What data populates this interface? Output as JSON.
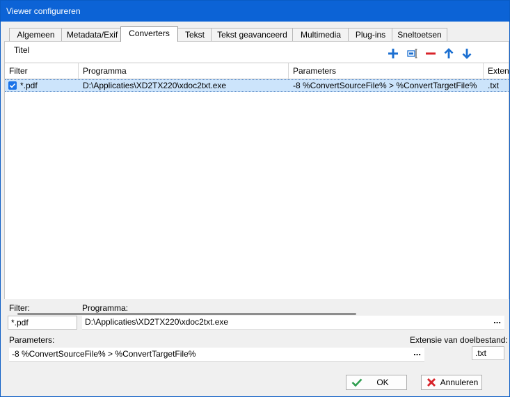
{
  "window": {
    "title": "Viewer configureren"
  },
  "tabs": [
    {
      "label": "Algemeen"
    },
    {
      "label": "Metadata/Exif"
    },
    {
      "label": "Converters"
    },
    {
      "label": "Tekst"
    },
    {
      "label": "Tekst geavanceerd"
    },
    {
      "label": "Multimedia"
    },
    {
      "label": "Plug-ins"
    },
    {
      "label": "Sneltoetsen"
    }
  ],
  "active_tab": "Converters",
  "panel": {
    "titel_label": "Titel"
  },
  "toolbar": {
    "icons": [
      "add-icon",
      "rename-icon",
      "remove-icon",
      "arrow-up-icon",
      "arrow-down-icon"
    ],
    "colors": {
      "blue": "#1b6fd1",
      "red": "#d8232a"
    }
  },
  "grid": {
    "columns": [
      "Filter",
      "Programma",
      "Parameters",
      "Exten"
    ],
    "rows": [
      {
        "checked": true,
        "filter": "*.pdf",
        "programma": "D:\\Applicaties\\XD2TX220\\xdoc2txt.exe",
        "parameters": "-8 %ConvertSourceFile% > %ConvertTargetFile%",
        "extensie": ".txt"
      }
    ]
  },
  "form": {
    "filter_label": "Filter:",
    "filter_value": "*.pdf",
    "programma_label": "Programma:",
    "programma_value": "D:\\Applicaties\\XD2TX220\\xdoc2txt.exe",
    "parameters_label": "Parameters:",
    "parameters_value": "-8 %ConvertSourceFile% > %ConvertTargetFile%",
    "extensie_label": "Extensie van doelbestand:",
    "extensie_value": ".txt",
    "browse_label": "..."
  },
  "buttons": {
    "ok_label": "OK",
    "cancel_label": "Annuleren",
    "ok_color": "#2e9e4f",
    "cancel_color": "#d8232a"
  }
}
